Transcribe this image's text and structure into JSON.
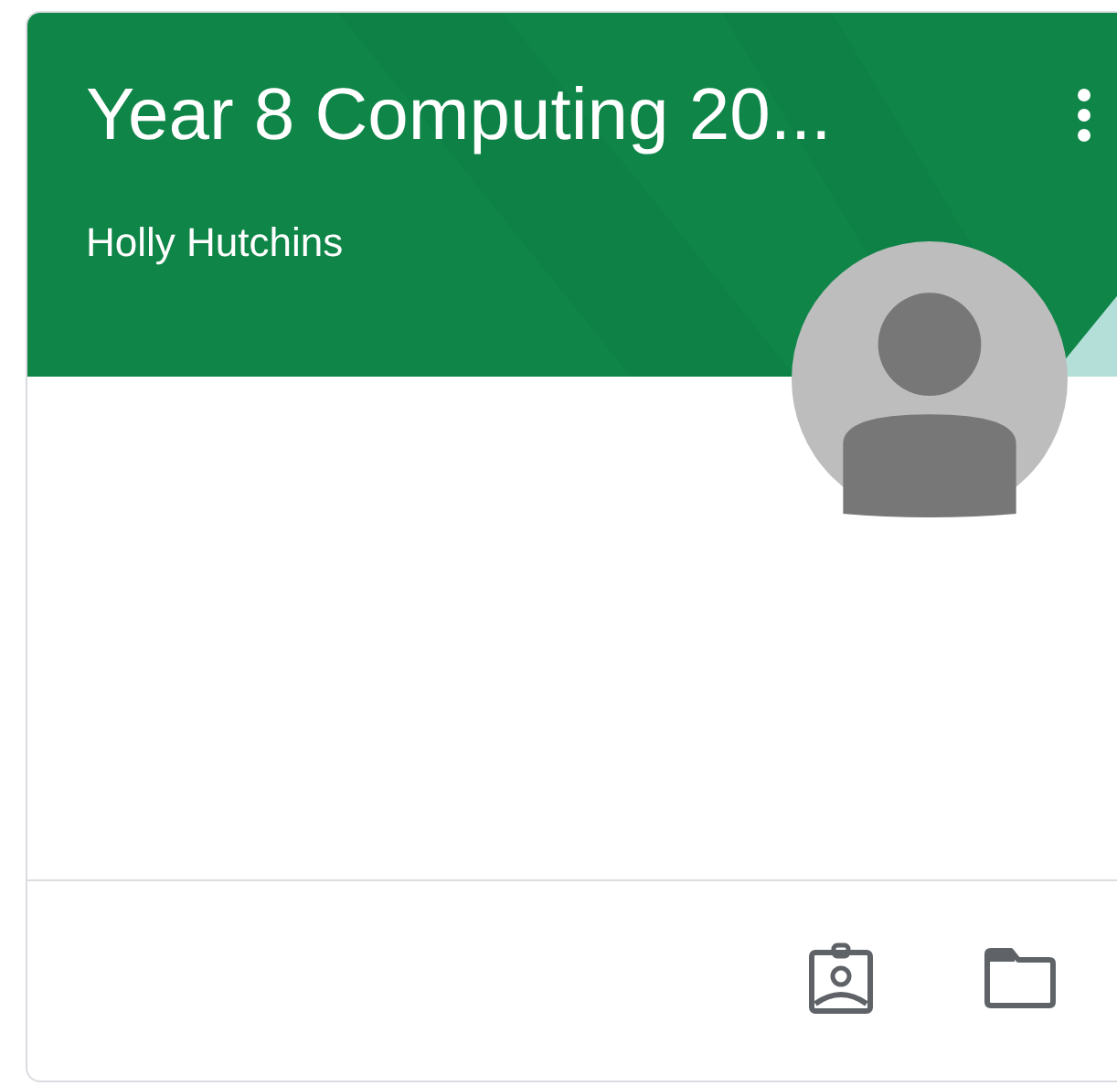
{
  "card": {
    "title": "Year 8 Computing 20...",
    "teacher": "Holly Hutchins"
  }
}
